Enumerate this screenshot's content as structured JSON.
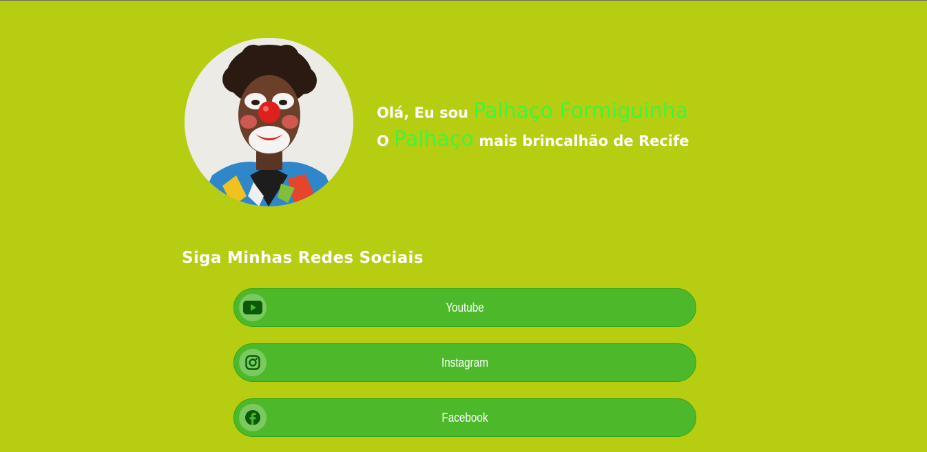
{
  "profile": {
    "greeting_prefix": "Olá, Eu sou",
    "name": "Palhaço Formiguinha",
    "line2_prefix": "O",
    "line2_highlight": "Palhaço",
    "line2_suffix": "mais brincalhão de Recife"
  },
  "social": {
    "title": "Siga Minhas Redes Sociais",
    "links": [
      {
        "label": "Youtube",
        "icon": "youtube-icon"
      },
      {
        "label": "Instagram",
        "icon": "instagram-icon"
      },
      {
        "label": "Facebook",
        "icon": "facebook-icon"
      }
    ]
  },
  "colors": {
    "background": "#b7cd12",
    "button": "#4eb82b",
    "highlight": "#3cf53e",
    "icon": "#0b5a0b"
  }
}
